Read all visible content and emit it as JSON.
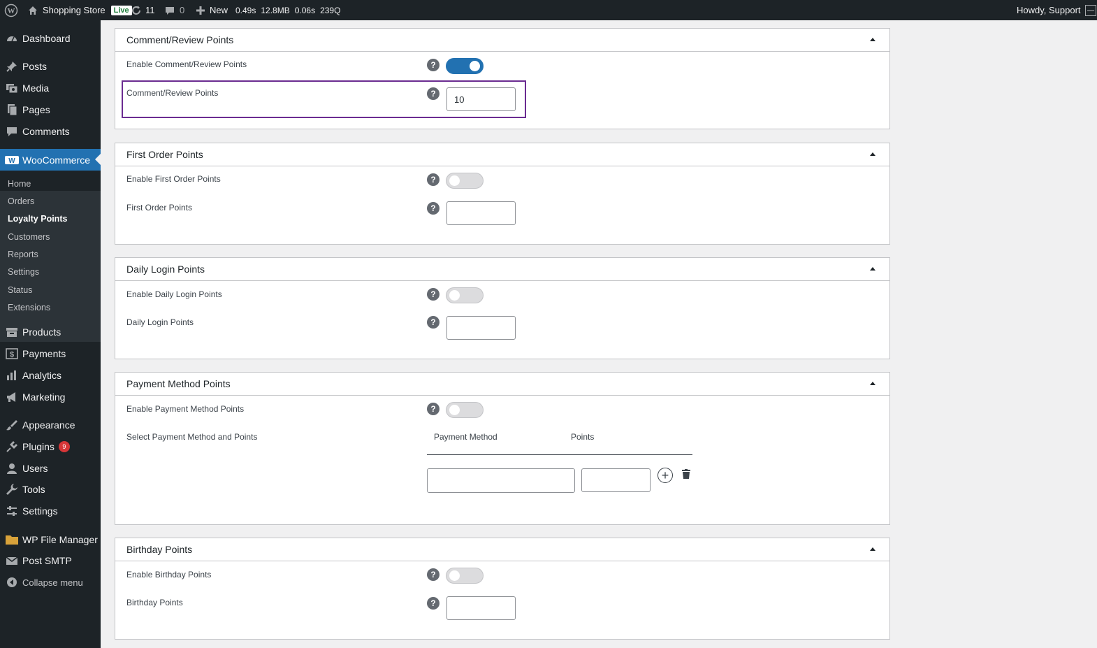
{
  "adminbar": {
    "site_name": "Shopping Store",
    "live_badge": "Live",
    "updates_count": "11",
    "comments_count": "0",
    "new_label": "New",
    "perf_time": "0.49s",
    "perf_memory": "12.8MB",
    "perf_db_time": "0.06s",
    "perf_queries": "239Q",
    "howdy": "Howdy, Support"
  },
  "sidebar": {
    "dashboard": "Dashboard",
    "posts": "Posts",
    "media": "Media",
    "pages": "Pages",
    "comments": "Comments",
    "woocommerce": "WooCommerce",
    "sub": [
      "Home",
      "Orders",
      "Loyalty Points",
      "Customers",
      "Reports",
      "Settings",
      "Status",
      "Extensions"
    ],
    "products": "Products",
    "payments": "Payments",
    "analytics": "Analytics",
    "marketing": "Marketing",
    "appearance": "Appearance",
    "plugins": "Plugins",
    "plugins_badge": "9",
    "users": "Users",
    "tools": "Tools",
    "settings": "Settings",
    "file_manager": "WP File Manager",
    "post_smtp": "Post SMTP",
    "collapse": "Collapse menu"
  },
  "sections": {
    "comment": {
      "title": "Comment/Review Points",
      "enable_label": "Enable Comment/Review Points",
      "enabled": true,
      "points_label": "Comment/Review Points",
      "points_value": "10"
    },
    "first_order": {
      "title": "First Order Points",
      "enable_label": "Enable First Order Points",
      "enabled": false,
      "points_label": "First Order Points",
      "points_value": ""
    },
    "daily_login": {
      "title": "Daily Login Points",
      "enable_label": "Enable Daily Login Points",
      "enabled": false,
      "points_label": "Daily Login Points",
      "points_value": ""
    },
    "payment": {
      "title": "Payment Method Points",
      "enable_label": "Enable Payment Method Points",
      "enabled": false,
      "select_label": "Select Payment Method and Points",
      "col_method": "Payment Method",
      "col_points": "Points"
    },
    "birthday": {
      "title": "Birthday Points",
      "enable_label": "Enable Birthday Points",
      "enabled": false,
      "points_label": "Birthday Points",
      "points_value": ""
    }
  },
  "help_glyph": "?",
  "colors": {
    "accent": "#2271b1",
    "highlight": "#6b2c91",
    "adminbar": "#1d2327"
  }
}
